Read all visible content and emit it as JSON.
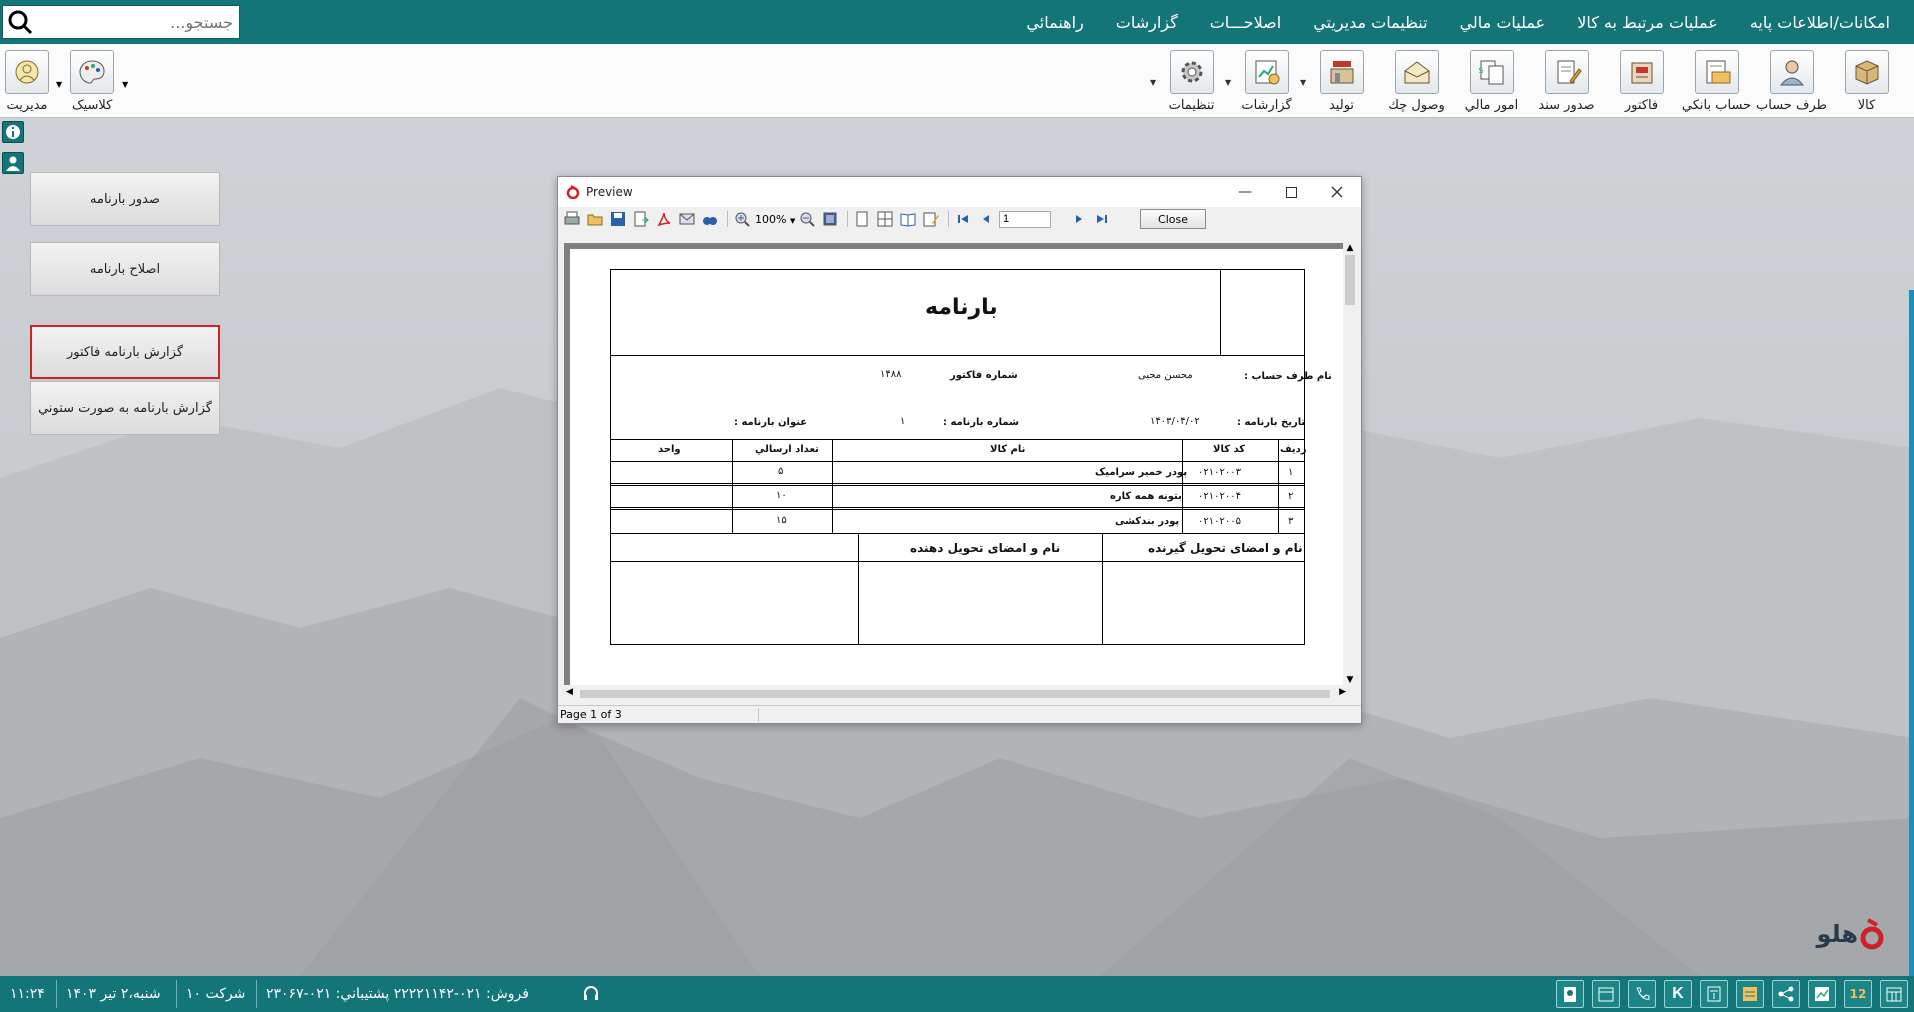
{
  "menu": {
    "items": [
      "امکانات/اطلاعات پايه",
      "عمليات مرتبط به کالا",
      "عمليات مالي",
      "تنظيمات مديريتي",
      "اصلاحـــات",
      "گزارشات",
      "راهنمائي"
    ]
  },
  "search": {
    "placeholder": "جستجو..."
  },
  "toolbar": {
    "right_items": [
      {
        "label": "کالا",
        "icon": "box-icon"
      },
      {
        "label": "طرف حساب",
        "icon": "person-icon"
      },
      {
        "label": "حساب بانکي",
        "icon": "bank-card-icon"
      },
      {
        "label": "فاکتور",
        "icon": "register-icon"
      },
      {
        "label": "صدور سند",
        "icon": "document-edit-icon"
      },
      {
        "label": "امور مالي",
        "icon": "money-docs-icon"
      },
      {
        "label": "وصول چك",
        "icon": "cheque-icon"
      },
      {
        "label": "توليد",
        "icon": "factory-icon"
      },
      {
        "label": "گزارشات",
        "icon": "report-chart-icon"
      },
      {
        "label": "تنظيمات",
        "icon": "gear-icon"
      }
    ],
    "left_items": [
      {
        "label": "مديريت",
        "icon": "admin-icon"
      },
      {
        "label": "کلاسیک",
        "icon": "palette-icon"
      }
    ]
  },
  "panel": {
    "buttons": [
      "صدور بارنامه",
      "اصلاح بارنامه",
      "گزارش بارنامه فاکتور",
      "گزارش بارنامه به صورت ستوني"
    ],
    "selected_index": 2
  },
  "preview": {
    "title": "Preview",
    "zoom": "100%",
    "page_number": "1",
    "close_label": "Close",
    "status": "Page 1 of 3",
    "report": {
      "title": "بارنامه",
      "account_label": "نام طرف حساب :",
      "account_value": "محسن محبی",
      "invoice_no_label": "شماره فاكتور",
      "invoice_no_value": "۱۴۸۸",
      "date_label": "تاريخ بارنامه :",
      "date_value": "۱۴۰۳/۰۴/۰۲",
      "waybill_no_label": "شماره بارنامه :",
      "waybill_no_value": "۱",
      "waybill_title_label": "عنوان بارنامه :",
      "columns": [
        "رديف",
        "كد كالا",
        "نام كالا",
        "تعداد ارسالي",
        "واحد"
      ],
      "rows": [
        {
          "row": "۱",
          "code": "۰۲۱۰۲۰۰۳",
          "name": "پودر خمیر سرامیک",
          "qty": "۵",
          "unit": ""
        },
        {
          "row": "۲",
          "code": "۰۲۱۰۲۰۰۴",
          "name": "بتونه همه کاره",
          "qty": "۱۰",
          "unit": ""
        },
        {
          "row": "۳",
          "code": "۰۲۱۰۲۰۰۵",
          "name": "پودر بندکشی",
          "qty": "۱۵",
          "unit": ""
        }
      ],
      "receiver_sign": "نام و امضای تحويل گيرنده",
      "sender_sign": "نام و امضای تحويل دهنده"
    }
  },
  "statusbar": {
    "time": "۱۱:۲۴",
    "date": "شنبه،۲ تير ۱۴۰۳",
    "company": "شركت ۱۰",
    "contact": "فروش: ۰۲۱-۲۲۲۲۱۱۴۲  پشتيباني: ۰۲۱-۲۳۰۶۷",
    "calendar_day": "12"
  },
  "logo": {
    "text": "هلو"
  },
  "colors": {
    "teal": "#137577",
    "selected_border": "#d0202a"
  }
}
